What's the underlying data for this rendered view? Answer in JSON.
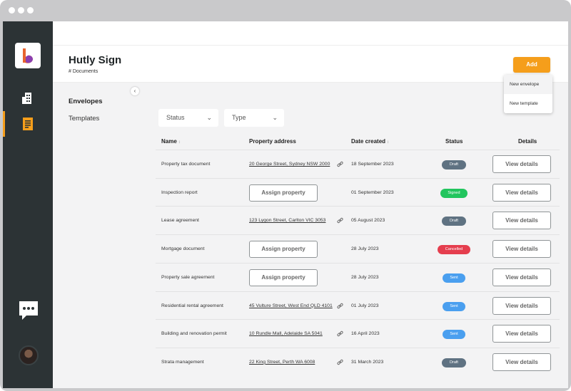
{
  "app": {
    "title": "Hutly Sign",
    "breadcrumb": "# Documents"
  },
  "header": {
    "add_label": "Add"
  },
  "add_menu": [
    "New envelope",
    "New template"
  ],
  "subnav": {
    "items": [
      "Envelopes",
      "Templates"
    ],
    "collapse_icon": "‹"
  },
  "filters": {
    "status": "Status",
    "type": "Type",
    "chevron": "⌄"
  },
  "table": {
    "headers": {
      "name": "Name",
      "address": "Property address",
      "date": "Date created",
      "status": "Status",
      "details": "Details"
    },
    "sort_icon": "↕",
    "assign_label": "Assign property",
    "details_label": "View details",
    "rows": [
      {
        "name": "Property tax document",
        "address": "20 George Street, Sydney NSW 2000",
        "date": "18 September 2023",
        "status": "Draft"
      },
      {
        "name": "Inspection report",
        "address": "",
        "date": "01 September 2023",
        "status": "Signed"
      },
      {
        "name": "Lease agreement",
        "address": "123 Lygon Street, Carlton VIC 3053",
        "date": "05 August 2023",
        "status": "Draft"
      },
      {
        "name": "Mortgage document",
        "address": "",
        "date": "28 July 2023",
        "status": "Cancelled"
      },
      {
        "name": "Property sale agreement",
        "address": "",
        "date": "28 July 2023",
        "status": "Sent"
      },
      {
        "name": "Residential rental agreement",
        "address": "45 Vulture Street, West End QLD 4101",
        "date": "01 July 2023",
        "status": "Sent"
      },
      {
        "name": "Building and renovation permit",
        "address": "10 Rundle Mall, Adelaide SA 5041",
        "date": "16 April 2023",
        "status": "Sent"
      },
      {
        "name": "Strata management",
        "address": "22 King Street, Perth WA 6008",
        "date": "31 March 2023",
        "status": "Draft"
      }
    ]
  },
  "status_colors": {
    "Draft": "#5f7282",
    "Signed": "#22c55e",
    "Cancelled": "#e53e4e",
    "Sent": "#4a9fef"
  },
  "colors": {
    "accent": "#f59e1b",
    "rail": "#2c3335"
  }
}
